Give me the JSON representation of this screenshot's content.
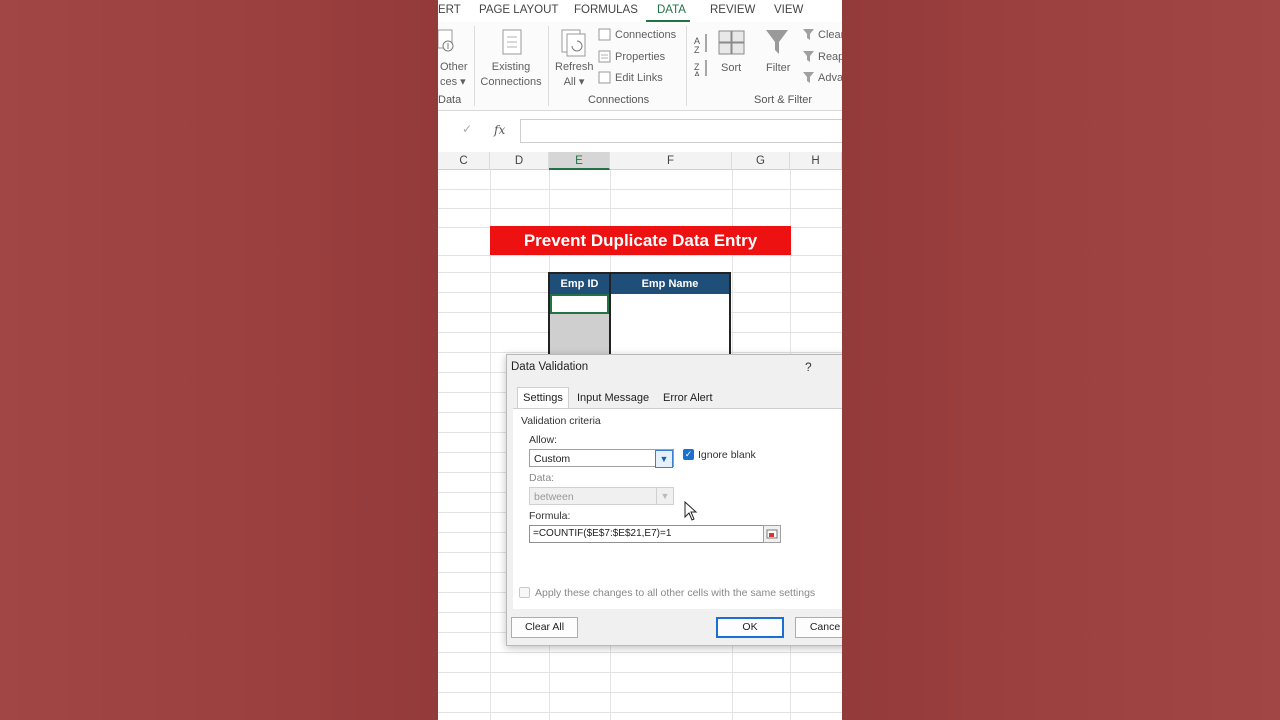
{
  "ribbon_tabs": [
    "ERT",
    "PAGE LAYOUT",
    "FORMULAS",
    "DATA",
    "REVIEW",
    "VIEW"
  ],
  "active_tab": "DATA",
  "ribbon": {
    "get_external_data": {
      "other_sources": "Other\nces",
      "group_label": "Data"
    },
    "existing_connections": "Existing\nConnections",
    "refresh_all": "Refresh\nAll",
    "connections": "Connections",
    "properties": "Properties",
    "edit_links": "Edit Links",
    "connections_group": "Connections",
    "sort": "Sort",
    "filter": "Filter",
    "clear": "Clear",
    "reapply": "Reap",
    "advanced": "Adva",
    "sort_filter_group": "Sort & Filter"
  },
  "formula_bar": {
    "fx": "fx",
    "value": ""
  },
  "columns": [
    "C",
    "D",
    "E",
    "F",
    "G",
    "H"
  ],
  "selected_column": "E",
  "sheet": {
    "banner": "Prevent Duplicate Data Entry",
    "headers": [
      "Emp ID",
      "Emp Name"
    ]
  },
  "dialog": {
    "title": "Data Validation",
    "help": "?",
    "tabs": [
      "Settings",
      "Input Message",
      "Error Alert"
    ],
    "active_tab": "Settings",
    "section": "Validation criteria",
    "allow_label": "Allow:",
    "allow_value": "Custom",
    "ignore_blank": "Ignore blank",
    "ignore_blank_checked": true,
    "data_label": "Data:",
    "data_value": "between",
    "formula_label": "Formula:",
    "formula_value": "=COUNTIF($E$7:$E$21,E7)=1",
    "apply_all": "Apply these changes to all other cells with the same settings",
    "apply_all_checked": false,
    "clear_all": "Clear All",
    "ok": "OK",
    "cancel": "Cance"
  },
  "colors": {
    "excel_green": "#217346",
    "banner_red": "#ee1111",
    "header_blue": "#1f4e79",
    "frame_red": "#9b3f3f"
  }
}
